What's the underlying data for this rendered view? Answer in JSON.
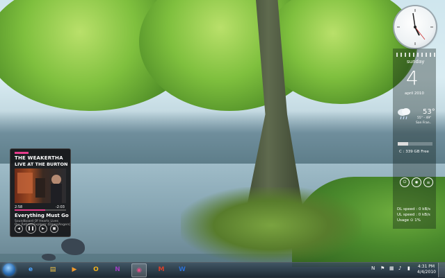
{
  "media_player": {
    "artist": "THE WEAKERTHA",
    "subtitle": "LIVE AT THE BURTON",
    "time_elapsed": "2:58",
    "time_remaining": "-2:03",
    "progress": 0.59,
    "song": "Everything Must Go (Liv",
    "album_line1": "Soundboard Of Hearts Lives",
    "album_line2": "Our Retired Explorer (Dines/Angers)",
    "controls": [
      "previous-icon",
      "pause-icon",
      "next-icon",
      "stop-icon"
    ],
    "accent_color": "#e63c8c"
  },
  "calendar": {
    "day_name": "sunday",
    "date": "4",
    "month_year": "april 2010"
  },
  "weather": {
    "temperature": "53°",
    "range": "55° - 49°",
    "city": "San Fran..",
    "icon": "rain-cloud-icon"
  },
  "drive": {
    "label": "C : 339 GB Free",
    "used_fraction": 0.3
  },
  "power_buttons": [
    "power-icon",
    "restart-icon",
    "lock-icon"
  ],
  "network": {
    "dl_speed": "DL speed : 0 kB/s",
    "ul_speed": "UL speed : 0 kB/s",
    "usage": "Usage ⊙ 1%"
  },
  "taskbar": {
    "pinned": [
      {
        "name": "internet-explorer",
        "glyph": "e",
        "color": "#4aa3ff"
      },
      {
        "name": "file-explorer",
        "glyph": "▤",
        "color": "#f2c64a"
      },
      {
        "name": "media-player",
        "glyph": "▶",
        "color": "#f39a2c"
      },
      {
        "name": "outlook",
        "glyph": "O",
        "color": "#f2b21b"
      },
      {
        "name": "onenote",
        "glyph": "N",
        "color": "#9b3fbf"
      },
      {
        "name": "zune",
        "glyph": "◉",
        "color": "#e0508a"
      },
      {
        "name": "gmail",
        "glyph": "M",
        "color": "#d8402a"
      },
      {
        "name": "word",
        "glyph": "W",
        "color": "#2b6fd1"
      }
    ],
    "clock_time": "4:31 PM",
    "clock_date": "4/4/2010",
    "tray_icons": [
      "onenote-tray-icon",
      "flag-icon",
      "network-icon",
      "volume-icon",
      "battery-icon"
    ]
  }
}
